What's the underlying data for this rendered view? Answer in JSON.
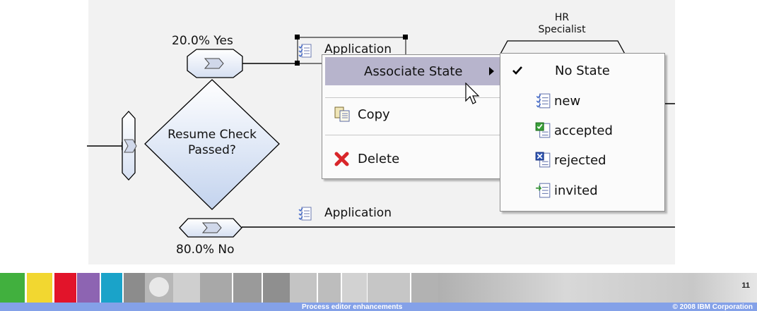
{
  "diagram": {
    "yes_branch_label": "20.0% Yes",
    "no_branch_label": "80.0% No",
    "decision_label_line1": "Resume Check",
    "decision_label_line2": "Passed?",
    "selected_artifact_label": "Application",
    "lower_artifact_label": "Application",
    "swimlane_label_line1": "HR",
    "swimlane_label_line2": "Specialist"
  },
  "context_menu": {
    "items": [
      {
        "label": "Associate State",
        "icon": "submenu-arrow"
      },
      {
        "label": "Copy",
        "icon": "copy-icon"
      },
      {
        "label": "Delete",
        "icon": "delete-icon"
      }
    ]
  },
  "state_submenu": {
    "items": [
      {
        "label": "No State",
        "icon": "check-icon",
        "checked": true
      },
      {
        "label": "new",
        "icon": "state-new-icon"
      },
      {
        "label": "accepted",
        "icon": "state-accepted-icon"
      },
      {
        "label": "rejected",
        "icon": "state-rejected-icon"
      },
      {
        "label": "invited",
        "icon": "state-invited-icon"
      }
    ]
  },
  "footer": {
    "title": "Process editor enhancements",
    "copyright": "© 2008 IBM Corporation",
    "page_number": "11"
  },
  "colors": {
    "decision_fill_top": "#ffffff",
    "decision_fill_bottom": "#c3d3ee",
    "menu_highlight": "#b7b4cc",
    "footer_bar": "#84a1e8"
  }
}
